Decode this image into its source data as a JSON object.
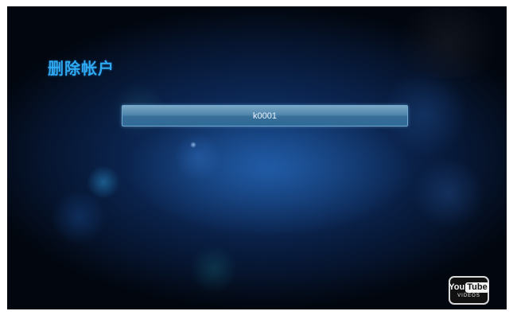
{
  "screen": {
    "title": "删除帐户"
  },
  "accounts": [
    {
      "label": "k0001"
    }
  ],
  "badge": {
    "you": "You",
    "tube": "Tube",
    "subtitle": "VIDEOS"
  }
}
